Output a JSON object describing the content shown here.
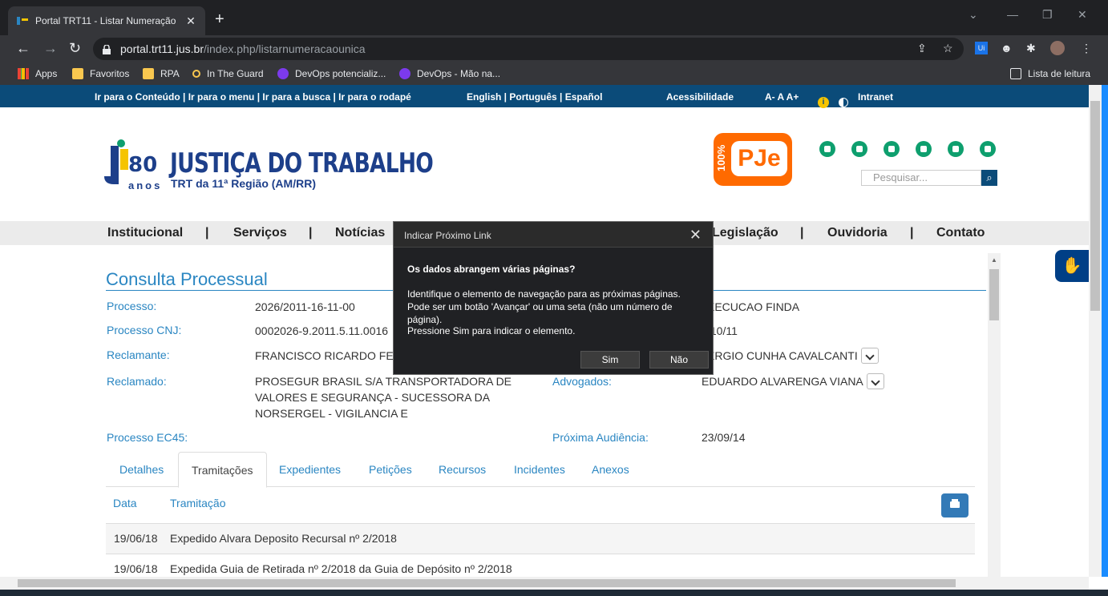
{
  "browser": {
    "tab_title": "Portal TRT11 - Listar Numeração",
    "url_host": "portal.trt11.jus.br",
    "url_path": "/index.php/listarnumeracaounica",
    "bookmarks": [
      "Apps",
      "Favoritos",
      "RPA",
      "In The Guard",
      "DevOps potencializ...",
      "DevOps - Mão na..."
    ],
    "reading_list": "Lista de leitura"
  },
  "topbar": {
    "skip_links": "Ir para o Conteúdo | Ir para o menu | Ir para a busca | Ir para o rodapé",
    "languages": "English | Português |  Español",
    "accessibility": "Acessibilidade",
    "font_controls": "A-  A  A+",
    "intranet": "Intranet"
  },
  "header": {
    "logo_title": "JUSTIÇA DO TRABALHO",
    "logo_subtitle": "TRT da 11ª Região (AM/RR)",
    "logo_years": "80",
    "logo_anos": "anos",
    "pje_label": "PJe",
    "pje_pct": "100%",
    "search_placeholder": "Pesquisar..."
  },
  "menu": [
    "Institucional",
    "|",
    "Serviços",
    "|",
    "Notícias",
    "Legislação",
    "|",
    "Ouvidoria",
    "|",
    "Contato"
  ],
  "content": {
    "title": "Consulta Processual",
    "fields": {
      "processo_label": "Processo:",
      "processo_value": "2026/2011-16-11-00",
      "cnj_label": "Processo CNJ:",
      "cnj_value": "0002026-9.2011.5.11.0016",
      "reclamante_label": "Reclamante:",
      "reclamante_value": "FRANCISCO RICARDO FE",
      "reclamado_label": "Reclamado:",
      "reclamado_value": "PROSEGUR BRASIL S/A TRANSPORTADORA DE VALORES E SEGURANÇA - SUCESSORA DA NORSERGEL - VIGILANCIA E",
      "ec45_label": "Processo EC45:",
      "status_value": "XECUCAO FINDA",
      "date_value": "/10/11",
      "adv1_value": "ERGIO CUNHA CAVALCANTI",
      "advogados_label": "Advogados:",
      "adv2_value": "EDUARDO ALVARENGA VIANA",
      "audiencia_label": "Próxima Audiência:",
      "audiencia_value": "23/09/14"
    },
    "tabs": [
      "Detalhes",
      "Tramitações",
      "Expedientes",
      "Petições",
      "Recursos",
      "Incidentes",
      "Anexos"
    ],
    "table_headers": [
      "Data",
      "Tramitação"
    ],
    "rows": [
      {
        "date": "19/06/18",
        "text": "Expedido Alvara Deposito Recursal nº 2/2018"
      },
      {
        "date": "19/06/18",
        "text": "Expedida Guia de Retirada nº 2/2018 da Guia de Depósito nº 2/2018"
      }
    ]
  },
  "modal": {
    "title": "Indicar Próximo Link",
    "question": "Os dados abrangem várias páginas?",
    "body": "Identifique o elemento de navegação para as próximas páginas. Pode ser um botão 'Avançar' ou uma seta (não um número de página).",
    "instruction": "Pressione Sim para indicar o elemento.",
    "yes": "Sim",
    "no": "Não"
  },
  "colors": {
    "brand_blue": "#0b4b79",
    "link_blue": "#2a86c2",
    "pje_orange": "#ff6a00",
    "social_green": "#0e9f6e"
  }
}
